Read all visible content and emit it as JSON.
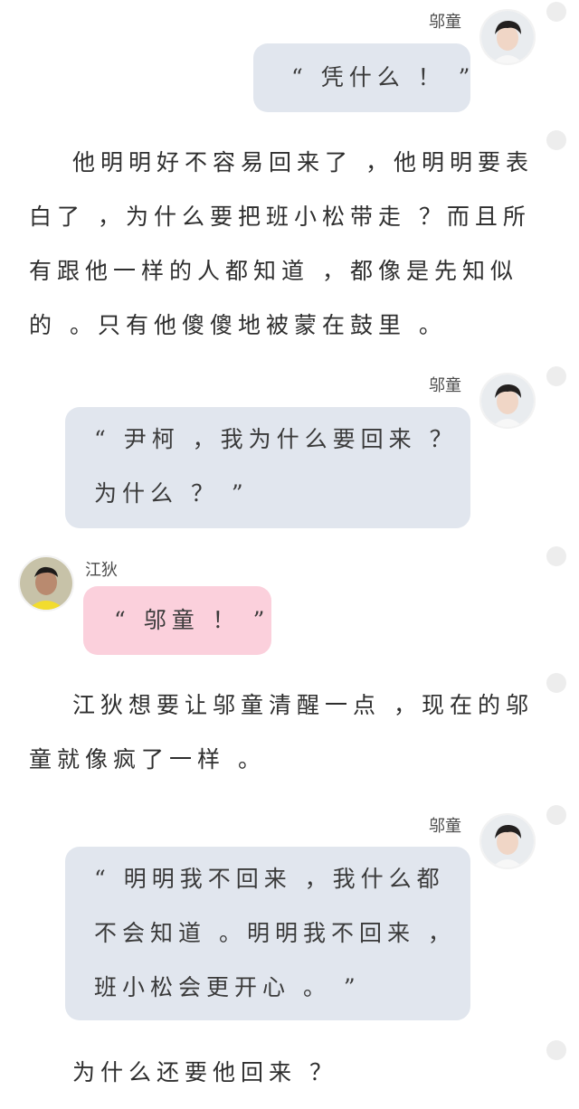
{
  "speakers": {
    "wu_tong": "邬童",
    "jiang_di": "江狄"
  },
  "messages": [
    {
      "lines": [
        "“ 凭什么 ！ ”"
      ]
    },
    {
      "lines": [
        "“ 尹柯 ，我为什么要回来 ？",
        "为什么 ？ ”"
      ]
    },
    {
      "lines": [
        "“ 邬童 ！ ”"
      ]
    },
    {
      "lines": [
        "“ 明明我不回来 ，我什么都",
        "不会知道 。明明我不回来 ，",
        "班小松会更开心 。 ”"
      ]
    }
  ],
  "narrations": [
    {
      "lines": [
        "他明明好不容易回来了 ，他明明要表",
        "白了 ，为什么要把班小松带走 ？而且所",
        "有跟他一样的人都知道 ，都像是先知似",
        "的 。只有他傻傻地被蒙在鼓里 。"
      ]
    },
    {
      "lines": [
        "江狄想要让邬童清醒一点 ，现在的邬",
        "童就像疯了一样 。"
      ]
    },
    {
      "lines": [
        "为什么还要他回来 ？"
      ]
    }
  ],
  "colors": {
    "bubble_right": "#e1e6ee",
    "bubble_left": "#fbd0dc",
    "side_dot": "#ededed"
  }
}
